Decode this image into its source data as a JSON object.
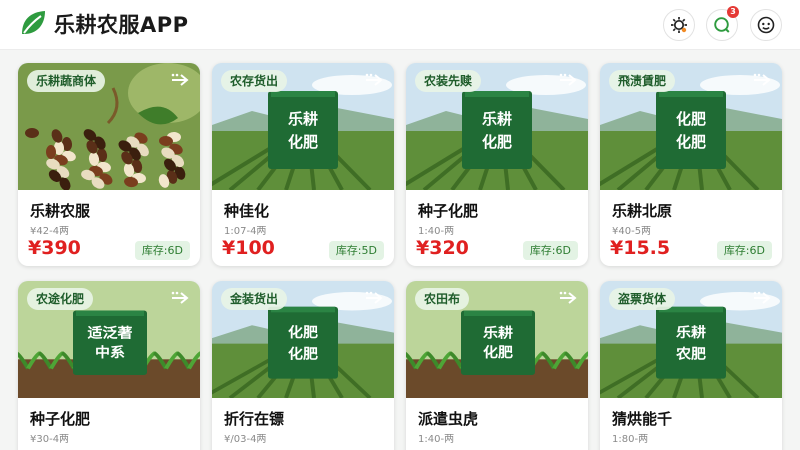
{
  "app": {
    "title": "乐耕农服APP",
    "notification_count": "3"
  },
  "header_icons": [
    "settings-icon",
    "message-icon",
    "profile-icon"
  ],
  "colors": {
    "brand_green": "#2e7d32",
    "price_red": "#e02020"
  },
  "products": [
    {
      "tag": "乐耕蔬商体",
      "name": "乐耕农服",
      "spec": "¥42-4两",
      "price": "¥390",
      "stock": "库存:6D",
      "image": "seeds"
    },
    {
      "tag": "农存货出",
      "name": "种佳化",
      "spec": "1:07-4两",
      "price": "¥100",
      "stock": "库存:5D",
      "image": "bag-field",
      "bag_text": [
        "乐耕",
        "化肥"
      ]
    },
    {
      "tag": "农装先赎",
      "name": "种子化肥",
      "spec": "1:40-两",
      "price": "¥320",
      "stock": "库存:6D",
      "image": "bag-field",
      "bag_text": [
        "乐耕",
        "化肥"
      ]
    },
    {
      "tag": "飛渍賃肥",
      "name": "乐耕北原",
      "spec": "¥40-5两",
      "price": "¥15.5",
      "stock": "库存:6D",
      "image": "bag-field",
      "bag_text": [
        "化肥",
        "化肥"
      ]
    },
    {
      "tag": "农途化肥",
      "name": "种子化肥",
      "spec": "¥30-4两",
      "image": "bag-sprouts",
      "bag_text": [
        "适泛著",
        "中系"
      ]
    },
    {
      "tag": "金装货出",
      "name": "折行在镖",
      "spec": "¥/03-4两",
      "image": "bag-field",
      "bag_text": [
        "化肥",
        "化肥"
      ]
    },
    {
      "tag": "农田布",
      "name": "派遣虫虎",
      "spec": "1:40-两",
      "image": "bag-sprouts",
      "bag_text": [
        "乐耕",
        "化肥"
      ]
    },
    {
      "tag": "盗票货体",
      "name": "猜烘能千",
      "spec": "1:80-两",
      "image": "bag-field",
      "bag_text": [
        "乐耕",
        "农肥"
      ]
    }
  ]
}
